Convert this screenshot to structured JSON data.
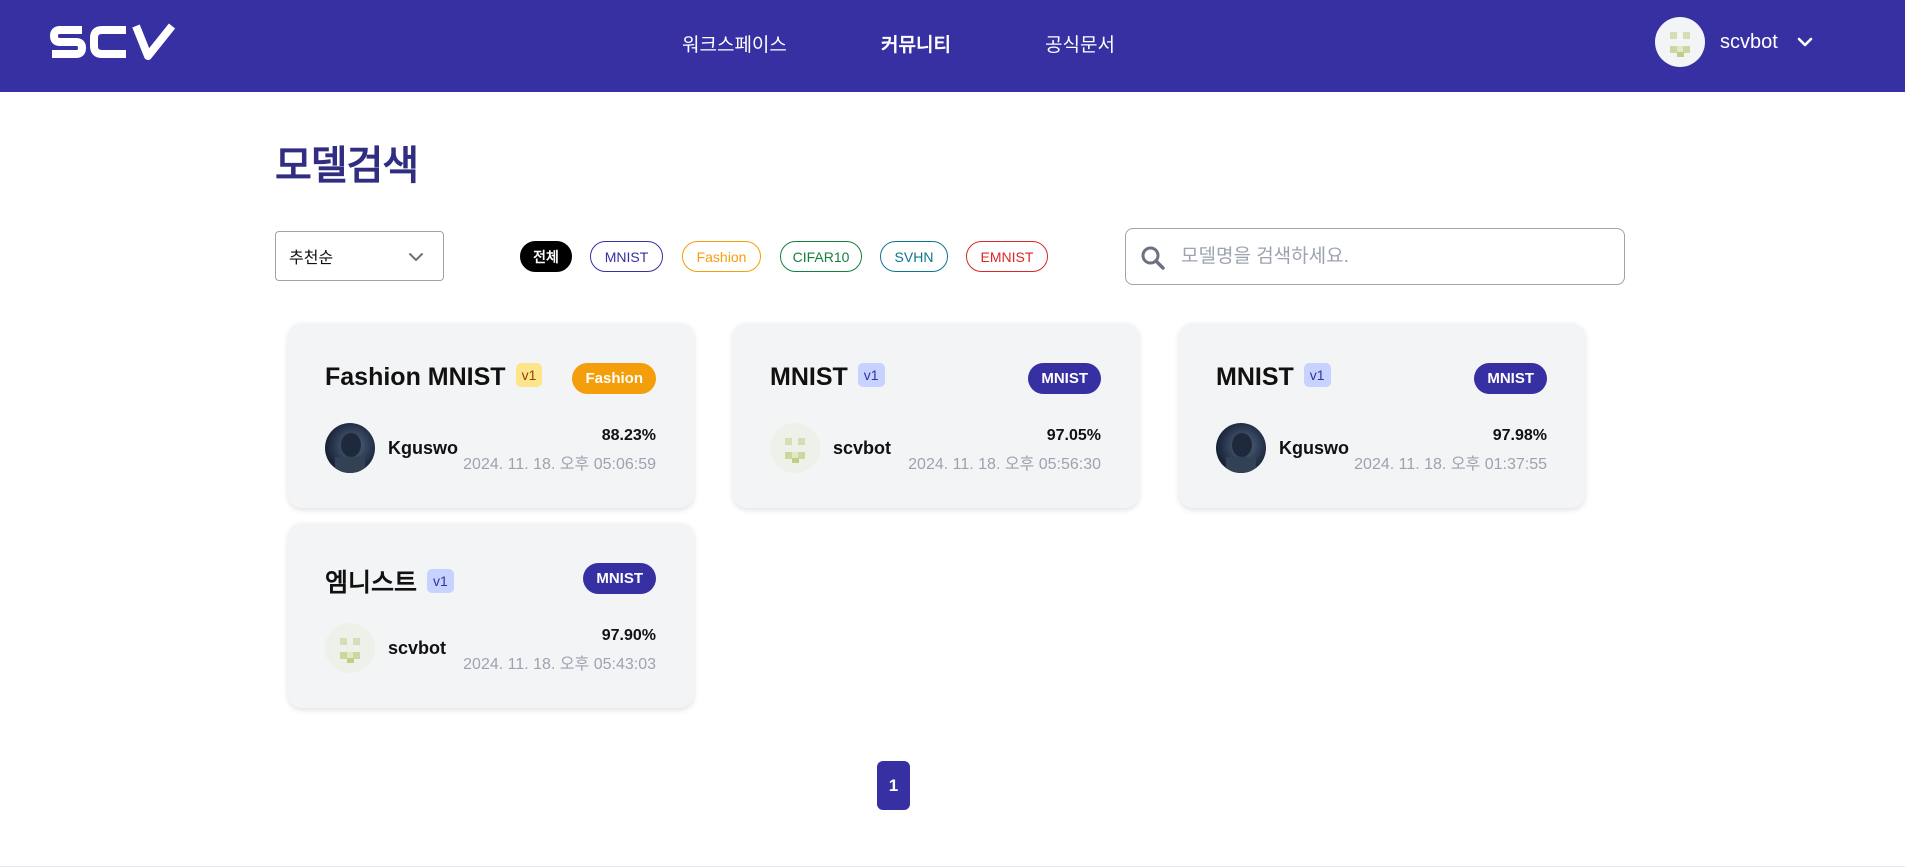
{
  "header": {
    "logo_text": "SCV",
    "nav": [
      "워크스페이스",
      "커뮤니티",
      "공식문서"
    ],
    "active_nav": "커뮤니티",
    "user_name": "scvbot",
    "bg_color": "#3730a3"
  },
  "page_title": "모델검색",
  "sort": {
    "selected": "추천순",
    "icon": "chevron-down-icon"
  },
  "filters": [
    "전체",
    "MNIST",
    "Fashion",
    "CIFAR10",
    "SVHN",
    "EMNIST"
  ],
  "search": {
    "placeholder": "모델명을 검색하세요.",
    "value": "",
    "icon": "search-icon"
  },
  "models": [
    {
      "name": "Fashion MNIST",
      "version": "v1",
      "tag": "Fashion",
      "tag_color": "#f59e0b",
      "user": "Kguswo",
      "accuracy": "88.23%",
      "date": "2024. 11. 18. 오후 05:06:59"
    },
    {
      "name": "MNIST",
      "version": "v1",
      "tag": "MNIST",
      "tag_color": "#3730a3",
      "user": "scvbot",
      "accuracy": "97.05%",
      "date": "2024. 11. 18. 오후 05:56:30"
    },
    {
      "name": "MNIST",
      "version": "v1",
      "tag": "MNIST",
      "tag_color": "#3730a3",
      "user": "Kguswo",
      "accuracy": "97.98%",
      "date": "2024. 11. 18. 오후 01:37:55"
    },
    {
      "name": "엠니스트",
      "version": "v1",
      "tag": "MNIST",
      "tag_color": "#3730a3",
      "user": "scvbot",
      "accuracy": "97.90%",
      "date": "2024. 11. 18. 오후 05:43:03"
    }
  ],
  "pagination": {
    "current": "1"
  }
}
